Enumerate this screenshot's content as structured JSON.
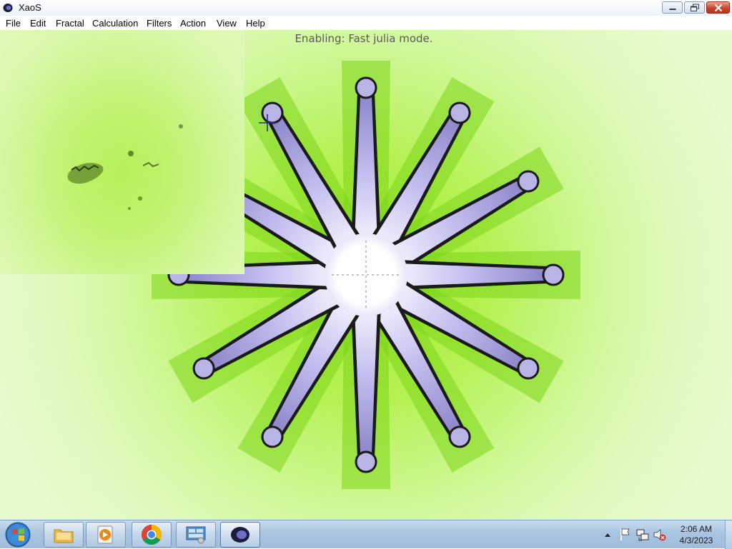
{
  "window": {
    "title": "XaoS",
    "app_icon": "xaos-icon"
  },
  "menu": {
    "items": [
      {
        "label": "File"
      },
      {
        "label": "Edit"
      },
      {
        "label": "Fractal"
      },
      {
        "label": "Calculation"
      },
      {
        "label": "Filters"
      },
      {
        "label": "Action"
      },
      {
        "label": "View"
      },
      {
        "label": "Help"
      }
    ]
  },
  "canvas": {
    "status_message": "Enabling: Fast julia mode.",
    "fractal_colors": {
      "background": "#c4f57b",
      "inner": "#ffffff",
      "arms": "#b9b4e6",
      "edge": "#1a1a1a"
    }
  },
  "taskbar": {
    "start_icon": "windows-start-icon",
    "pinned": [
      {
        "icon": "file-explorer-icon"
      },
      {
        "icon": "media-player-icon"
      },
      {
        "icon": "chrome-icon"
      },
      {
        "icon": "control-panel-icon"
      },
      {
        "icon": "xaos-icon"
      }
    ],
    "tray": {
      "icons": [
        "show-hidden-icons-icon",
        "action-center-flag-icon",
        "network-icon",
        "volume-muted-icon"
      ],
      "time": "2:06 AM",
      "date": "4/3/2023"
    }
  }
}
